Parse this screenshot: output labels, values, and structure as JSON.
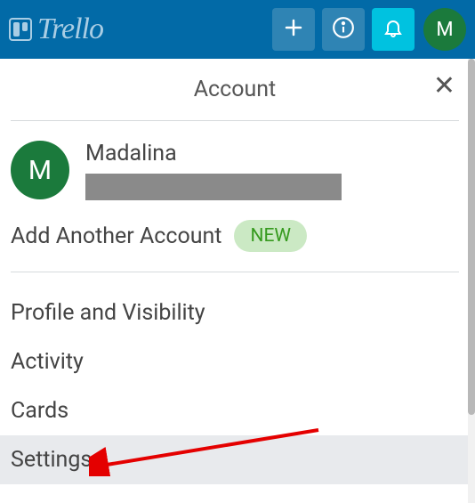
{
  "app": {
    "name": "Trello",
    "avatar_initial": "M"
  },
  "panel": {
    "title": "Account",
    "account": {
      "name": "Madalina",
      "avatar_initial": "M"
    },
    "add_account": {
      "label": "Add Another Account",
      "badge": "NEW"
    },
    "menu": {
      "profile": "Profile and Visibility",
      "activity": "Activity",
      "cards": "Cards",
      "settings": "Settings"
    }
  }
}
